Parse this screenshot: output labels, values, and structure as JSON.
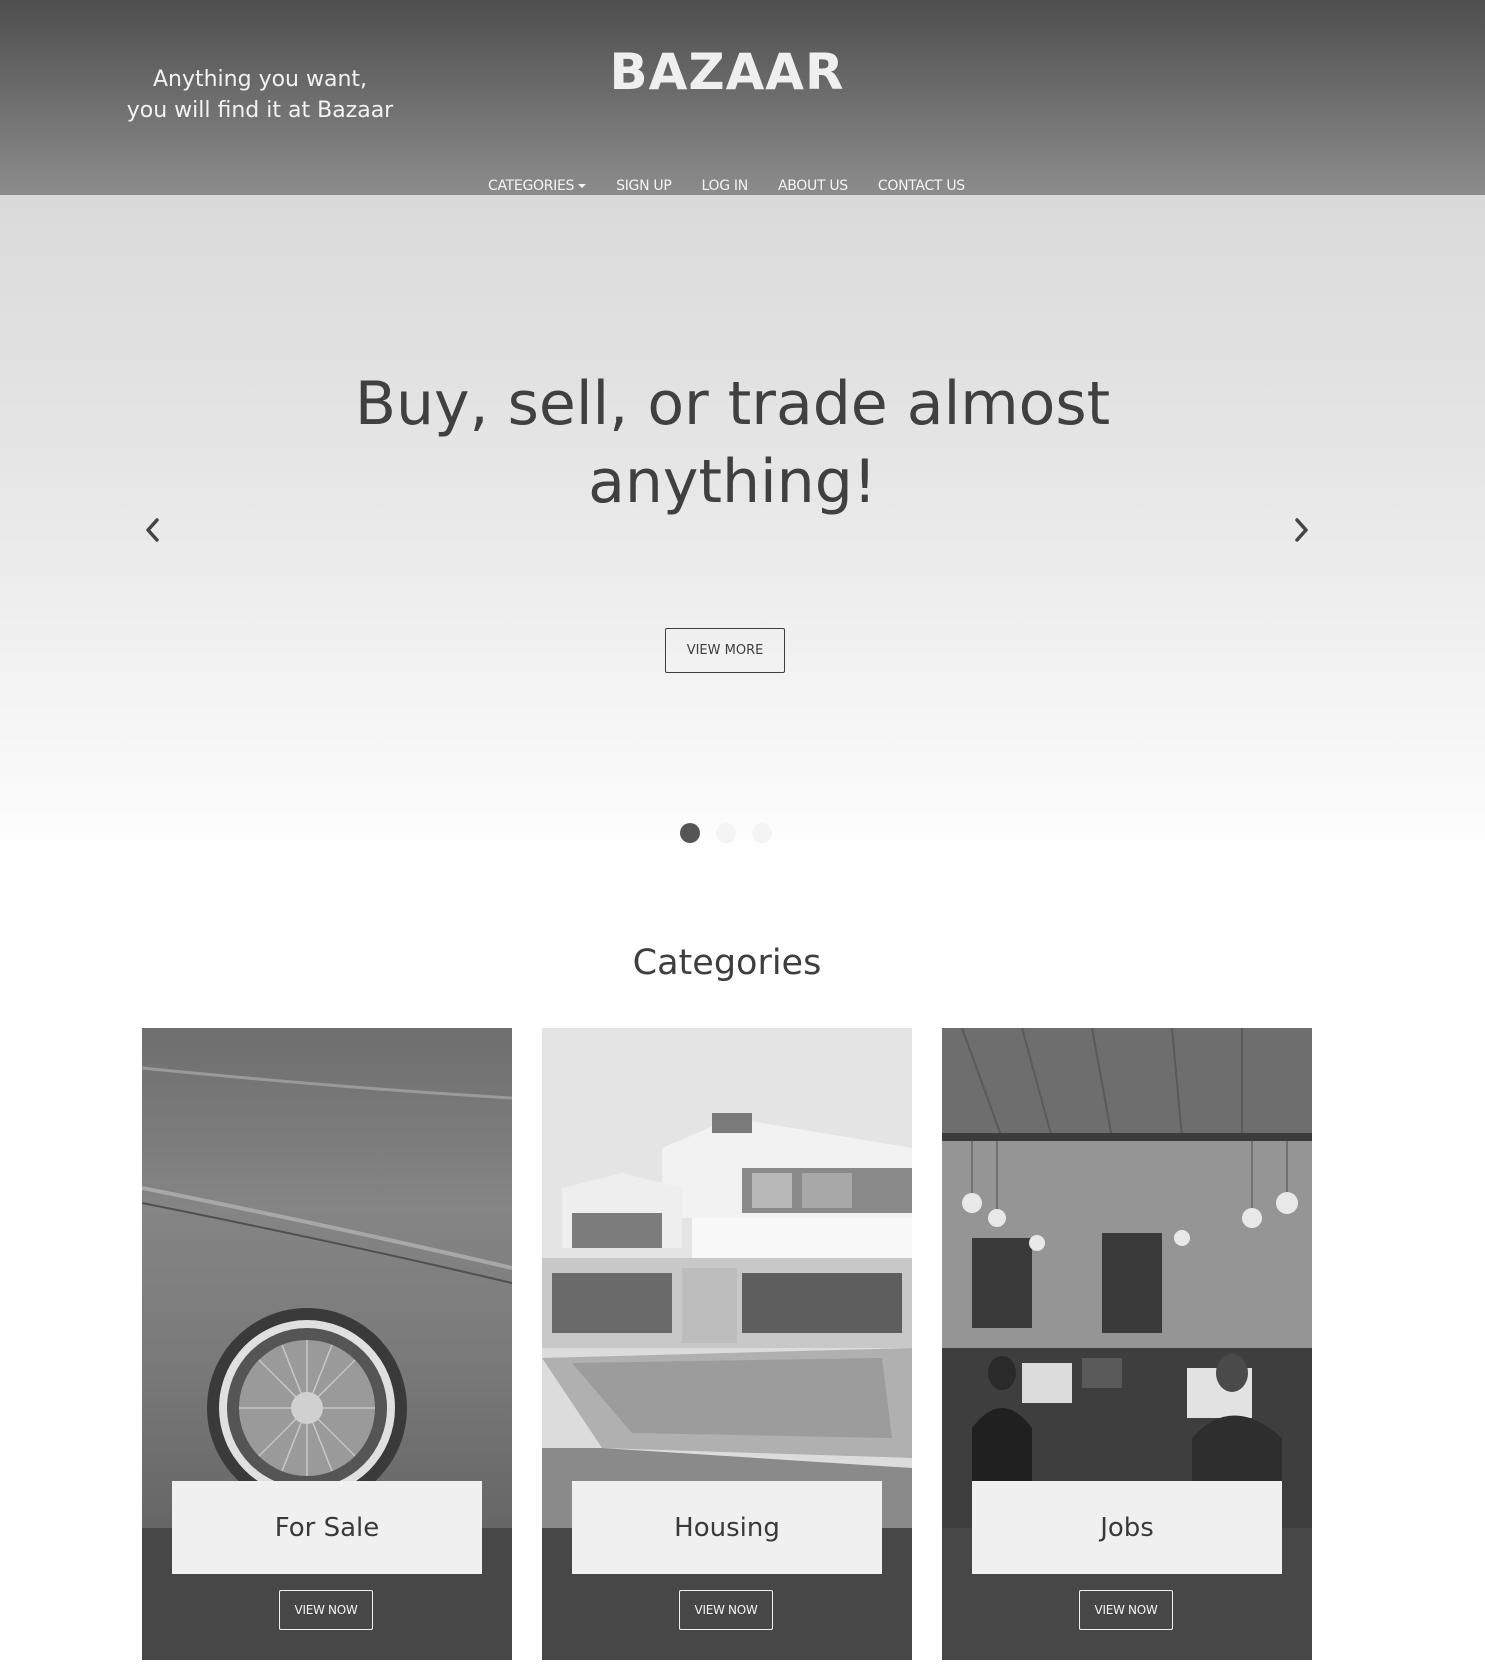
{
  "header": {
    "tagline_line1": "Anything you want,",
    "tagline_line2": "you will find it at Bazaar",
    "logo": "BAZAAR",
    "nav": [
      {
        "label": "CATEGORIES"
      },
      {
        "label": "SIGN UP"
      },
      {
        "label": "LOG IN"
      },
      {
        "label": "ABOUT US"
      },
      {
        "label": "CONTACT US"
      }
    ]
  },
  "hero": {
    "title": "Buy, sell, or trade almost anything!",
    "cta_label": "VIEW MORE",
    "slide_count": 3,
    "active_slide": 1
  },
  "categories": {
    "title": "Categories",
    "items": [
      {
        "label": "For Sale",
        "button": "VIEW NOW"
      },
      {
        "label": "Housing",
        "button": "VIEW NOW"
      },
      {
        "label": "Jobs",
        "button": "VIEW NOW"
      }
    ]
  },
  "colors": {
    "header_top": "#4e4e4e",
    "header_bottom": "#8c8c8c",
    "text_dark": "#3e3e3e",
    "card_background": "#474747",
    "label_box": "#f0f0f0"
  }
}
